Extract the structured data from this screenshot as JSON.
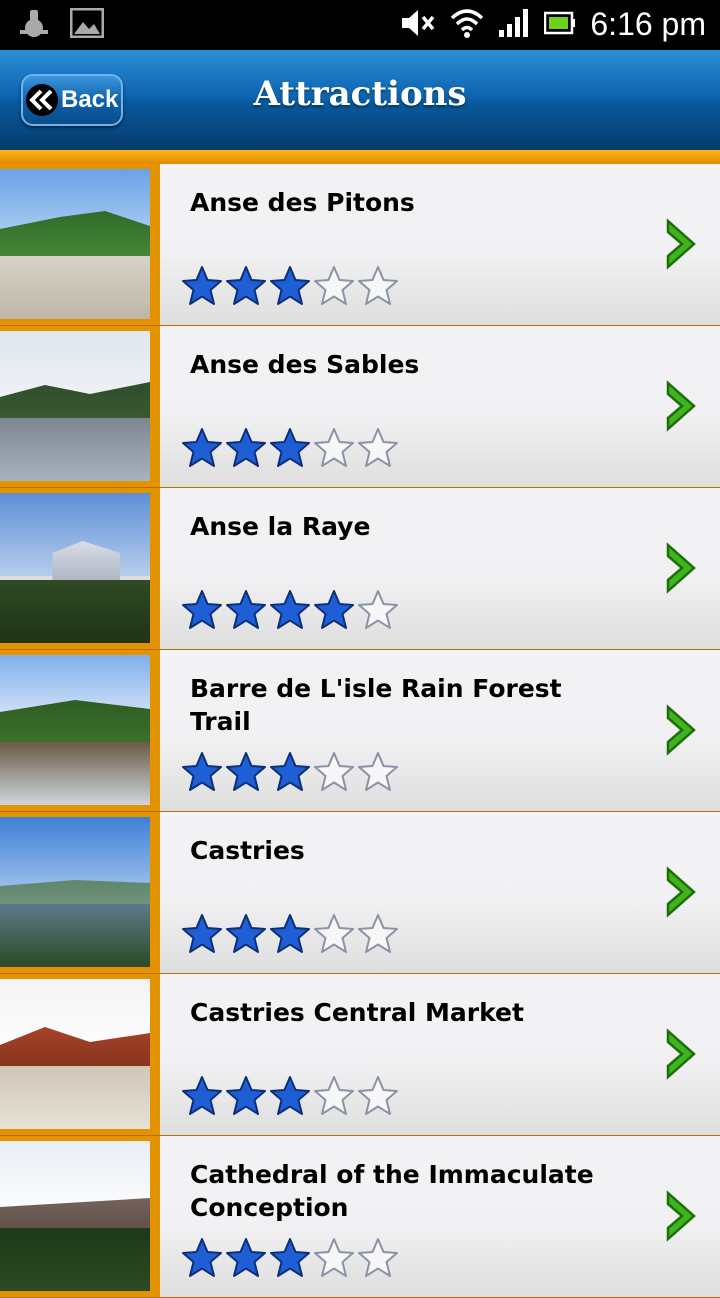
{
  "status_bar": {
    "time": "6:16 pm",
    "icons": [
      "usb-debug-icon",
      "image-notification-icon",
      "muted-icon",
      "wifi-icon",
      "signal-icon",
      "battery-icon"
    ]
  },
  "header": {
    "back_label": "Back",
    "title": "Attractions"
  },
  "colors": {
    "header_blue": "#0c62ad",
    "accent_orange": "#e39300",
    "star_blue": "#1f5fd6",
    "chevron_green": "#3fb51d"
  },
  "attractions": [
    {
      "name": "Anse des Pitons",
      "rating": 3,
      "max_rating": 5
    },
    {
      "name": "Anse des Sables",
      "rating": 3,
      "max_rating": 5
    },
    {
      "name": "Anse la Raye",
      "rating": 4,
      "max_rating": 5
    },
    {
      "name": "Barre de L'isle Rain Forest Trail",
      "rating": 3,
      "max_rating": 5
    },
    {
      "name": "Castries",
      "rating": 3,
      "max_rating": 5
    },
    {
      "name": "Castries Central Market",
      "rating": 3,
      "max_rating": 5
    },
    {
      "name": "Cathedral of the Immaculate Conception",
      "rating": 3,
      "max_rating": 5
    }
  ]
}
